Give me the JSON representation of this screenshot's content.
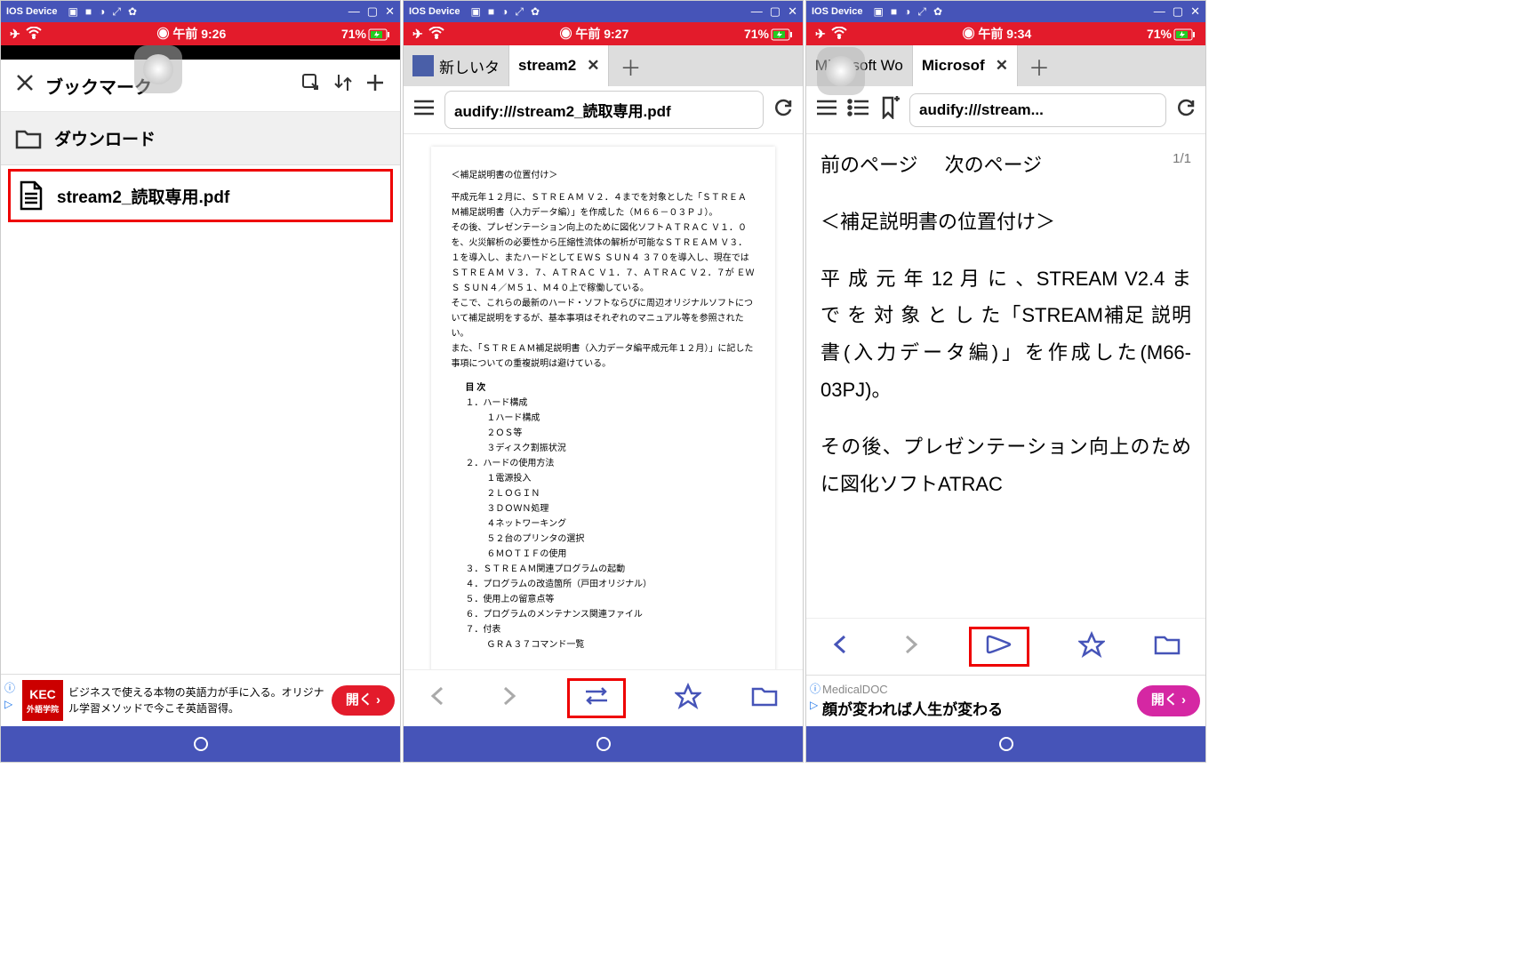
{
  "chrome": {
    "title": "IOS Device",
    "win_min": "—",
    "win_max": "▢",
    "win_close": "✕"
  },
  "status": {
    "times": [
      "午前 9:26",
      "午前 9:27",
      "午前 9:34"
    ],
    "battery": "71%"
  },
  "screen1": {
    "bookmarks_title": "ブックマーク",
    "downloads": "ダウンロード",
    "file": "stream2_読取専用.pdf",
    "ad": {
      "brand_top": "KEC",
      "brand_bottom": "外語学院",
      "text": "ビジネスで使える本物の英語力が手に入る。オリジナル学習メソッドで今こそ英語習得。",
      "cta": "開く ›"
    }
  },
  "screen2": {
    "tab1": "新しいタ",
    "tab2": "stream2",
    "url": "audify:///stream2_読取専用.pdf",
    "pdf": {
      "heading": "＜補足説明書の位置付け＞",
      "para": "平成元年１２月に、ＳＴＲＥＡＭ Ｖ２．４までを対象とした「ＳＴＲＥＡＭ補足説明書（入力データ編）」を作成した（Ｍ６６－０３ＰＪ）。\nその後、プレゼンテーション向上のために図化ソフトＡＴＲＡＣ Ｖ１．０を、火災解析の必要性から圧縮性流体の解析が可能なＳＴＲＥＡＭ Ｖ３．１を導入し、またハードとしてＥＷＳ ＳＵＮ４ ３７０を導入し、現在ではＳＴＲＥＡＭ Ｖ３．７、ＡＴＲＡＣ Ｖ１．７、ＡＴＲＡＣ Ｖ２．７が ＥＷＳ ＳＵＮ４／Ｍ５１、Ｍ４０上で稼働している。\nそこで、これらの最新のハード・ソフトならびに周辺オリジナルソフトについて補足説明をするが、基本事項はそれぞれのマニュアル等を参照されたい。\nまた、「ＳＴＲＥＡＭ補足説明書（入力データ編平成元年１２月）」に記した事項についての重複説明は避けている。",
      "toc_title": "目 次",
      "items": [
        "１．ハード構成",
        "　１ハード構成",
        "　２ＯＳ等",
        "　３ディスク割振状況",
        "２．ハードの使用方法",
        "　１電源投入",
        "　２ＬＯＧＩＮ",
        "　３ＤＯＷＮ処理",
        "　４ネットワーキング",
        "　５２台のプリンタの選択",
        "　６ＭＯＴＩＦの使用",
        "３．ＳＴＲＥＡＭ関連プログラムの起動",
        "４．プログラムの改造箇所（戸田オリジナル）",
        "５．使用上の留意点等",
        "６．プログラムのメンテナンス関連ファイル",
        "７．付表",
        "　ＧＲＡ３７コマンド一覧"
      ]
    }
  },
  "screen3": {
    "tab1": "Microsoft Wo",
    "tab2": "Microsof",
    "url": "audify:///stream...",
    "prev": "前のページ",
    "next": "次のページ",
    "page_num": "1/1",
    "h": "＜補足説明書の位置付け＞",
    "p1": "平 成 元 年 12 月 に 、STREAM V2.4 ま で を 対 象 と し た「STREAM補足 説明書(入力データ編)」を作成した(M66-03PJ)。",
    "p2": "その後、プレゼンテーション向上のために図化ソフトATRAC",
    "ad": {
      "brand": "MedicalDOC",
      "headline": "顔が変われば人生が変わる",
      "cta": "開く ›"
    }
  }
}
